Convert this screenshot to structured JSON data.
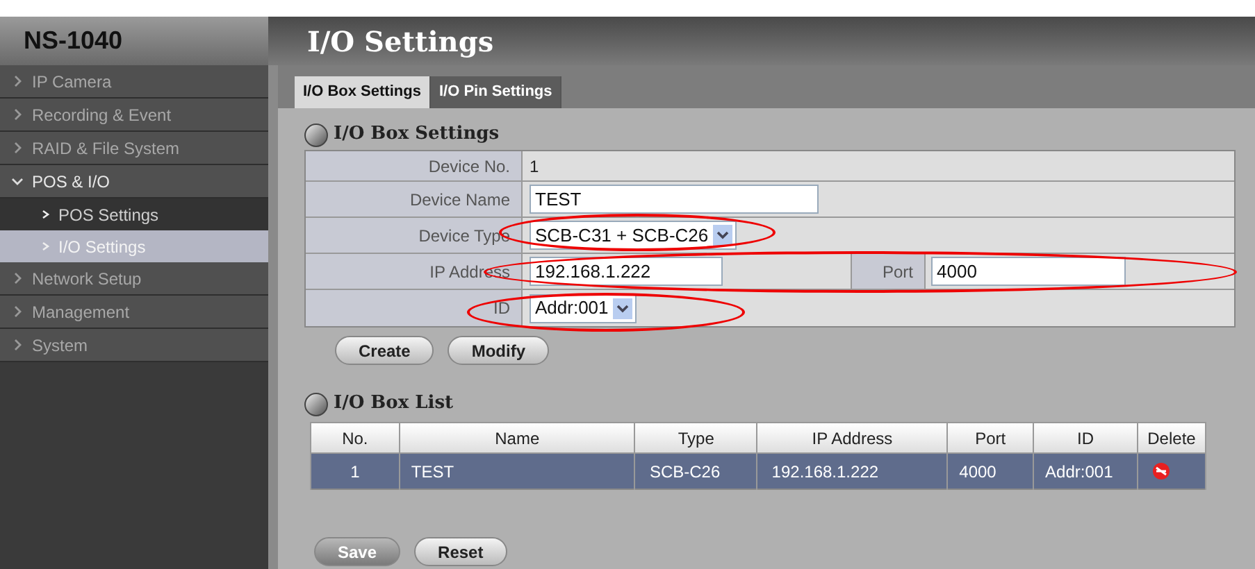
{
  "sidebar": {
    "title": "NS-1040",
    "items": [
      {
        "label": "IP Camera",
        "expanded": false,
        "selected": false
      },
      {
        "label": "Recording & Event",
        "expanded": false,
        "selected": false
      },
      {
        "label": "RAID & File System",
        "expanded": false,
        "selected": false
      },
      {
        "label": "POS & I/O",
        "expanded": true,
        "selected": false,
        "children": [
          {
            "label": "POS Settings",
            "selected": false
          },
          {
            "label": "I/O Settings",
            "selected": true
          }
        ]
      },
      {
        "label": "Network Setup",
        "expanded": false,
        "selected": false
      },
      {
        "label": "Management",
        "expanded": false,
        "selected": false
      },
      {
        "label": "System",
        "expanded": false,
        "selected": false
      }
    ]
  },
  "page_title": "I/O Settings",
  "tabs": [
    {
      "label": "I/O Box Settings",
      "selected": true
    },
    {
      "label": "I/O Pin Settings",
      "selected": false
    }
  ],
  "settings": {
    "title": "I/O Box Settings",
    "rows": [
      {
        "kind": "text",
        "label": "Device No.",
        "value": "1",
        "circled": false
      },
      {
        "kind": "input",
        "label": "Device Name",
        "value": "TEST",
        "circled": false
      },
      {
        "kind": "select",
        "label": "Device Type",
        "value": "SCB-C31 + SCB-C26",
        "circled": true
      },
      {
        "kind": "input",
        "label": "IP Address",
        "value": "192.168.1.222",
        "extra_label": "Port",
        "extra_value": "4000",
        "circled": true
      },
      {
        "kind": "select",
        "label": "ID",
        "value": "Addr:001",
        "circled": true
      }
    ]
  },
  "form_buttons": [
    {
      "label": "Create",
      "disabled": false
    },
    {
      "label": "Modify",
      "disabled": false
    }
  ],
  "list": {
    "title": "I/O Box List",
    "columns": [
      "No.",
      "Name",
      "Type",
      "IP Address",
      "Port",
      "ID",
      "Delete"
    ],
    "rows": [
      {
        "cells": [
          "1",
          "TEST",
          "SCB-C26",
          "192.168.1.222",
          "4000",
          "Addr:001"
        ],
        "selected": true
      }
    ]
  },
  "bottom_buttons": [
    {
      "label": "Save",
      "disabled": true
    },
    {
      "label": "Reset",
      "disabled": false
    }
  ]
}
